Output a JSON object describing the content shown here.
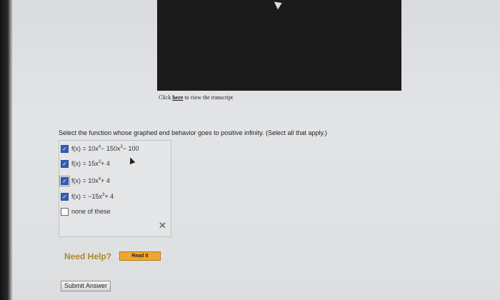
{
  "video": {
    "label": "video-player"
  },
  "transcript": {
    "prefix": "Click ",
    "link": "here",
    "suffix": " to view the transcript"
  },
  "question": "Select the function whose graphed end behavior goes to positive infinity. (Select all that apply.)",
  "options": [
    {
      "checked": true,
      "parts": [
        "f(x) = 10x",
        "4",
        " − 150x",
        "3",
        " − 100"
      ]
    },
    {
      "checked": true,
      "parts": [
        "f(x) = 15x",
        "3",
        " + 4",
        "",
        ""
      ]
    },
    {
      "checked": true,
      "parts": [
        "f(x) = 10x",
        "4",
        " + 4",
        "",
        ""
      ]
    },
    {
      "checked": true,
      "parts": [
        "f(x) = −15x",
        "3",
        " + 4",
        "",
        ""
      ]
    },
    {
      "checked": false,
      "parts": [
        "none of these",
        "",
        "",
        "",
        ""
      ]
    }
  ],
  "check_mark": "✓",
  "close_symbol": "✕",
  "help": {
    "label": "Need Help?",
    "button": "Read It"
  },
  "submit": "Submit Answer"
}
